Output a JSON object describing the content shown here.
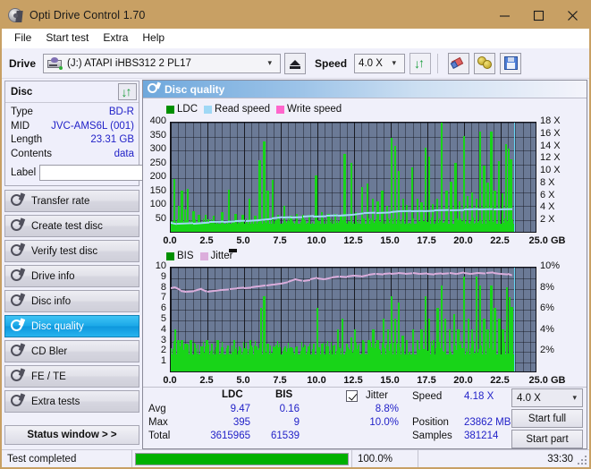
{
  "window": {
    "title": "Opti Drive Control 1.70",
    "icon": "disc-icon",
    "controls": {
      "minimize": "–",
      "maximize": "☐",
      "close": "✕"
    }
  },
  "menu": {
    "items": [
      "File",
      "Start test",
      "Extra",
      "Help"
    ]
  },
  "toolbar": {
    "drive_label": "Drive",
    "drive_value": "(J:)   ATAPI iHBS312   2 PL17",
    "eject_title": "eject-button",
    "speed_label": "Speed",
    "speed_value": "4.0 X",
    "buttons": [
      "refresh-icon",
      "eraser-icon",
      "coins-icon",
      "save-icon"
    ]
  },
  "sidebar": {
    "disc_panel": {
      "title": "Disc",
      "refresh_icon": "refresh-icon",
      "rows": [
        {
          "key": "Type",
          "value": "BD-R"
        },
        {
          "key": "MID",
          "value": "JVC-AMS6L (001)"
        },
        {
          "key": "Length",
          "value": "23.31 GB"
        },
        {
          "key": "Contents",
          "value": "data"
        }
      ],
      "label_key": "Label",
      "label_value": "",
      "label_placeholder": ""
    },
    "items": [
      {
        "label": "Transfer rate",
        "active": false
      },
      {
        "label": "Create test disc",
        "active": false
      },
      {
        "label": "Verify test disc",
        "active": false
      },
      {
        "label": "Drive info",
        "active": false
      },
      {
        "label": "Disc info",
        "active": false
      },
      {
        "label": "Disc quality",
        "active": true
      },
      {
        "label": "CD Bler",
        "active": false
      },
      {
        "label": "FE / TE",
        "active": false
      },
      {
        "label": "Extra tests",
        "active": false
      }
    ],
    "status_window_button": "Status window > >"
  },
  "panel": {
    "title": "Disc quality",
    "icon": "disc-quality-icon"
  },
  "chart_data": [
    {
      "type": "bar",
      "title": "Disc quality - LDC",
      "xlabel": "GB",
      "ylabel": "LDC",
      "xlim": [
        0,
        25
      ],
      "ylim": [
        0,
        400
      ],
      "y2lim": [
        0,
        18
      ],
      "y2label": "X",
      "grid": true,
      "legend_position": "top-left",
      "legend": [
        {
          "name": "LDC",
          "color": "#009000"
        },
        {
          "name": "Read speed",
          "color": "#9fd8f5"
        },
        {
          "name": "Write speed",
          "color": "#ff66cc"
        }
      ],
      "xticks": [
        "0.0",
        "2.5",
        "5.0",
        "7.5",
        "10.0",
        "12.5",
        "15.0",
        "17.5",
        "20.0",
        "22.5",
        "25.0 GB"
      ],
      "yticks": [
        50,
        100,
        150,
        200,
        250,
        300,
        350,
        400
      ],
      "y2ticks": [
        "2 X",
        "4 X",
        "6 X",
        "8 X",
        "10 X",
        "12 X",
        "14 X",
        "16 X",
        "18 X"
      ],
      "data_end_gb": 23.4,
      "baseline": 28,
      "spikes": [
        [
          0.25,
          190
        ],
        [
          0.55,
          95
        ],
        [
          0.75,
          150
        ],
        [
          0.95,
          82
        ],
        [
          1.15,
          155
        ],
        [
          1.55,
          75
        ],
        [
          1.9,
          60
        ],
        [
          2.35,
          62
        ],
        [
          2.9,
          58
        ],
        [
          3.5,
          70
        ],
        [
          3.95,
          152
        ],
        [
          4.4,
          64
        ],
        [
          4.9,
          60
        ],
        [
          5.35,
          120
        ],
        [
          5.75,
          58
        ],
        [
          6.05,
          258
        ],
        [
          6.35,
          326
        ],
        [
          6.6,
          150
        ],
        [
          6.95,
          186
        ],
        [
          7.3,
          62
        ],
        [
          7.75,
          95
        ],
        [
          8.2,
          58
        ],
        [
          8.6,
          66
        ],
        [
          9.0,
          62
        ],
        [
          9.45,
          60
        ],
        [
          9.9,
          202
        ],
        [
          10.3,
          70
        ],
        [
          10.75,
          64
        ],
        [
          11.2,
          66
        ],
        [
          11.6,
          60
        ],
        [
          11.85,
          280
        ],
        [
          12.3,
          250
        ],
        [
          12.6,
          70
        ],
        [
          13.05,
          160
        ],
        [
          13.4,
          175
        ],
        [
          13.75,
          120
        ],
        [
          14.1,
          110
        ],
        [
          14.4,
          150
        ],
        [
          14.75,
          95
        ],
        [
          15.05,
          338
        ],
        [
          15.3,
          310
        ],
        [
          15.55,
          218
        ],
        [
          15.85,
          120
        ],
        [
          16.1,
          96
        ],
        [
          16.45,
          232
        ],
        [
          16.8,
          120
        ],
        [
          17.1,
          106
        ],
        [
          17.35,
          302
        ],
        [
          17.6,
          272
        ],
        [
          17.85,
          100
        ],
        [
          18.15,
          118
        ],
        [
          18.45,
          392
        ],
        [
          18.8,
          150
        ],
        [
          19.1,
          180
        ],
        [
          19.4,
          250
        ],
        [
          19.7,
          110
        ],
        [
          20.0,
          345
        ],
        [
          20.25,
          128
        ],
        [
          20.55,
          142
        ],
        [
          20.85,
          120
        ],
        [
          21.1,
          360
        ],
        [
          21.35,
          240
        ],
        [
          21.6,
          176
        ],
        [
          21.85,
          362
        ],
        [
          22.1,
          150
        ],
        [
          22.35,
          256
        ],
        [
          22.6,
          138
        ],
        [
          22.85,
          316
        ],
        [
          23.05,
          300
        ],
        [
          23.2,
          262
        ]
      ],
      "read_speed": [
        [
          0.0,
          1.9
        ],
        [
          0.4,
          1.7
        ],
        [
          1.5,
          1.8
        ],
        [
          2.6,
          2.0
        ],
        [
          3.6,
          2.05
        ],
        [
          4.4,
          2.15
        ],
        [
          5.1,
          2.2
        ],
        [
          6.0,
          2.35
        ],
        [
          6.9,
          2.55
        ],
        [
          7.6,
          2.75
        ],
        [
          8.2,
          2.8
        ],
        [
          9.0,
          2.85
        ],
        [
          9.7,
          2.95
        ],
        [
          10.6,
          3.0
        ],
        [
          11.4,
          3.05
        ],
        [
          12.4,
          3.2
        ],
        [
          13.2,
          3.45
        ],
        [
          14.0,
          3.5
        ],
        [
          15.0,
          3.6
        ],
        [
          15.6,
          3.75
        ],
        [
          16.4,
          3.78
        ],
        [
          17.2,
          3.82
        ],
        [
          18.0,
          3.9
        ],
        [
          19.0,
          3.95
        ],
        [
          20.0,
          4.0
        ],
        [
          21.0,
          4.05
        ],
        [
          22.0,
          4.1
        ],
        [
          23.3,
          4.15
        ]
      ]
    },
    {
      "type": "bar",
      "title": "Disc quality - BIS / Jitter",
      "xlabel": "GB",
      "ylabel": "BIS",
      "xlim": [
        0,
        25
      ],
      "ylim": [
        0,
        10
      ],
      "y2lim": [
        0,
        10
      ],
      "y2label": "%",
      "grid": true,
      "legend_position": "top-left",
      "legend": [
        {
          "name": "BIS",
          "color": "#009000"
        },
        {
          "name": "Jitter",
          "color": "#dcaedc"
        }
      ],
      "xticks": [
        "0.0",
        "2.5",
        "5.0",
        "7.5",
        "10.0",
        "12.5",
        "15.0",
        "17.5",
        "20.0",
        "22.5",
        "25.0 GB"
      ],
      "yticks": [
        1,
        2,
        3,
        4,
        5,
        6,
        7,
        8,
        9,
        10
      ],
      "y2ticks": [
        "2%",
        "4%",
        "6%",
        "8%",
        "10%"
      ],
      "data_end_gb": 23.4,
      "baseline": 1.6,
      "spikes": [
        [
          0.3,
          4.0
        ],
        [
          0.5,
          3.0
        ],
        [
          0.75,
          3.0
        ],
        [
          1.0,
          2.6
        ],
        [
          1.35,
          3.0
        ],
        [
          1.7,
          2.2
        ],
        [
          2.1,
          2.4
        ],
        [
          2.45,
          3.0
        ],
        [
          2.8,
          2.6
        ],
        [
          3.2,
          3.0
        ],
        [
          3.5,
          2.3
        ],
        [
          3.9,
          2.5
        ],
        [
          4.3,
          3.0
        ],
        [
          4.7,
          2.4
        ],
        [
          5.05,
          2.2
        ],
        [
          5.4,
          3.0
        ],
        [
          5.8,
          2.4
        ],
        [
          6.15,
          6.0
        ],
        [
          6.35,
          7.1
        ],
        [
          6.6,
          2.6
        ],
        [
          7.0,
          2.4
        ],
        [
          7.4,
          2.3
        ],
        [
          7.8,
          2.4
        ],
        [
          8.2,
          2.3
        ],
        [
          8.6,
          2.4
        ],
        [
          9.0,
          2.3
        ],
        [
          9.4,
          2.4
        ],
        [
          9.75,
          2.6
        ],
        [
          10.0,
          6.0
        ],
        [
          10.3,
          2.6
        ],
        [
          10.7,
          2.4
        ],
        [
          11.1,
          2.5
        ],
        [
          11.4,
          4.0
        ],
        [
          11.7,
          5.0
        ],
        [
          12.0,
          2.6
        ],
        [
          12.3,
          3.2
        ],
        [
          12.55,
          4.0
        ],
        [
          12.8,
          2.5
        ],
        [
          13.1,
          3.0
        ],
        [
          13.5,
          3.0
        ],
        [
          13.8,
          4.0
        ],
        [
          14.1,
          3.0
        ],
        [
          14.5,
          5.0
        ],
        [
          14.8,
          4.0
        ],
        [
          15.05,
          7.1
        ],
        [
          15.3,
          5.0
        ],
        [
          15.55,
          6.5
        ],
        [
          15.8,
          3.4
        ],
        [
          16.1,
          3.0
        ],
        [
          16.5,
          4.0
        ],
        [
          16.8,
          3.0
        ],
        [
          17.1,
          4.0
        ],
        [
          17.35,
          7.1
        ],
        [
          17.6,
          5.0
        ],
        [
          17.9,
          3.0
        ],
        [
          18.2,
          6.0
        ],
        [
          18.45,
          8.1
        ],
        [
          18.7,
          5.0
        ],
        [
          19.0,
          4.0
        ],
        [
          19.3,
          5.4
        ],
        [
          19.6,
          4.0
        ],
        [
          20.0,
          9.0
        ],
        [
          20.3,
          5.0
        ],
        [
          20.55,
          4.0
        ],
        [
          20.85,
          9.0
        ],
        [
          21.1,
          8.1
        ],
        [
          21.35,
          5.0
        ],
        [
          21.6,
          4.0
        ],
        [
          21.85,
          8.1
        ],
        [
          22.1,
          6.0
        ],
        [
          22.4,
          5.0
        ],
        [
          22.65,
          4.0
        ],
        [
          22.9,
          8.0
        ],
        [
          23.1,
          7.0
        ],
        [
          23.25,
          6.1
        ]
      ],
      "jitter": [
        [
          0.0,
          8.1
        ],
        [
          0.3,
          8.2
        ],
        [
          0.7,
          7.9
        ],
        [
          1.1,
          7.8
        ],
        [
          1.6,
          7.85
        ],
        [
          2.1,
          8.05
        ],
        [
          2.5,
          7.8
        ],
        [
          3.0,
          7.9
        ],
        [
          3.5,
          8.0
        ],
        [
          4.0,
          8.05
        ],
        [
          4.5,
          8.1
        ],
        [
          5.0,
          8.15
        ],
        [
          5.5,
          8.2
        ],
        [
          6.0,
          8.3
        ],
        [
          6.5,
          8.4
        ],
        [
          7.0,
          8.5
        ],
        [
          7.5,
          8.6
        ],
        [
          8.0,
          8.75
        ],
        [
          8.5,
          9.0
        ],
        [
          9.0,
          8.85
        ],
        [
          9.5,
          8.95
        ],
        [
          10.0,
          9.1
        ],
        [
          10.5,
          9.0
        ],
        [
          11.0,
          9.15
        ],
        [
          11.5,
          9.25
        ],
        [
          12.0,
          9.2
        ],
        [
          12.5,
          9.3
        ],
        [
          13.0,
          9.25
        ],
        [
          13.5,
          9.4
        ],
        [
          14.0,
          9.5
        ],
        [
          14.5,
          9.45
        ],
        [
          15.0,
          9.5
        ],
        [
          15.5,
          9.55
        ],
        [
          16.0,
          9.5
        ],
        [
          16.5,
          9.55
        ],
        [
          17.0,
          9.45
        ],
        [
          17.5,
          9.5
        ],
        [
          18.0,
          9.45
        ],
        [
          18.5,
          9.5
        ],
        [
          19.0,
          9.55
        ],
        [
          19.5,
          9.45
        ],
        [
          20.0,
          9.6
        ],
        [
          20.5,
          9.5
        ],
        [
          21.0,
          9.6
        ],
        [
          21.5,
          9.55
        ],
        [
          22.0,
          9.6
        ],
        [
          22.5,
          9.5
        ],
        [
          23.0,
          9.45
        ],
        [
          23.3,
          9.3
        ]
      ]
    }
  ],
  "stats": {
    "col_headers": [
      "LDC",
      "BIS"
    ],
    "row_labels": [
      "Avg",
      "Max",
      "Total"
    ],
    "ldc": {
      "avg": "9.47",
      "max": "395",
      "total": "3615965"
    },
    "bis": {
      "avg": "0.16",
      "max": "9",
      "total": "61539"
    },
    "jitter": {
      "label": "Jitter",
      "checked": true,
      "avg": "8.8%",
      "max": "10.0%"
    },
    "speed_label": "Speed",
    "speed_value": "4.18 X",
    "position_label": "Position",
    "position_value": "23862 MB",
    "samples_label": "Samples",
    "samples_value": "381214",
    "speed_select": "4.0 X",
    "start_full_button": "Start full",
    "start_part_button": "Start part"
  },
  "statusbar": {
    "status": "Test completed",
    "progress_percent": "100.0%",
    "progress_value": 100,
    "elapsed": "33:30"
  },
  "colors": {
    "title_bar": "#c8a064",
    "accent_blue": "#2222c8",
    "selected_nav": "#1ba8e8",
    "chart_bg": "#6b7a96",
    "bar_green": "#18d418",
    "read_speed": "#9fd8f5",
    "jitter_pink": "#dcaedc",
    "progress_green": "#00b000"
  }
}
